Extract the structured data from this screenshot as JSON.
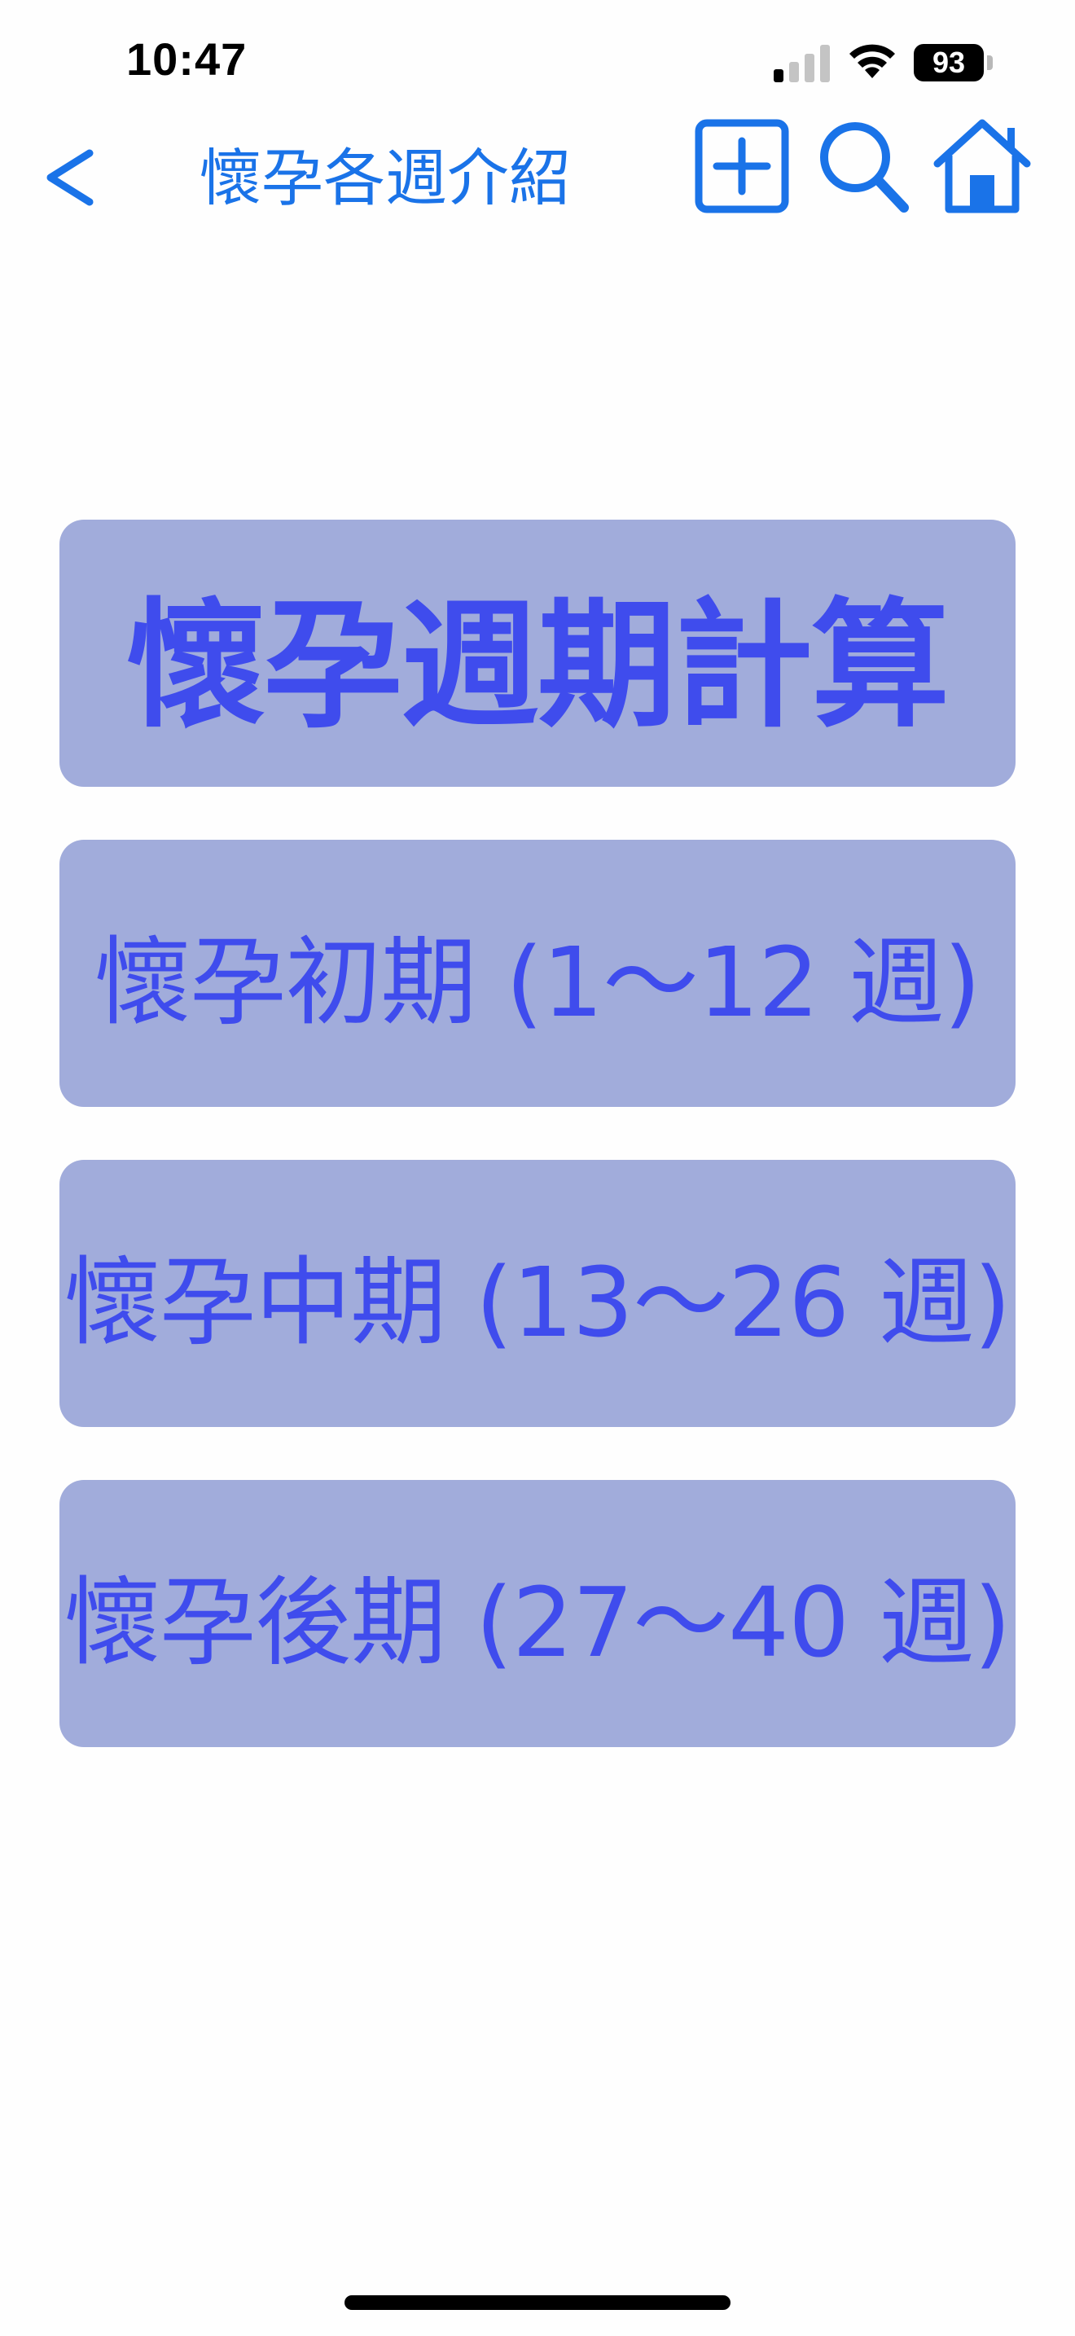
{
  "status_bar": {
    "time": "10:47",
    "battery": "93",
    "icons": [
      "signal-icon",
      "wifi-icon",
      "battery-icon"
    ]
  },
  "nav": {
    "title": "懷孕各週介紹",
    "icons": [
      "back-chevron-icon",
      "add-icon",
      "search-icon",
      "home-icon"
    ],
    "accent_color": "#1a73e8"
  },
  "menu": {
    "items": [
      {
        "label": "懷孕週期計算"
      },
      {
        "label": "懷孕初期 (1～12 週)"
      },
      {
        "label": "懷孕中期 (13～26 週)"
      },
      {
        "label": "懷孕後期 (27～40 週)"
      }
    ],
    "button_color": "#a1acdb",
    "text_color": "#3f4ced"
  }
}
